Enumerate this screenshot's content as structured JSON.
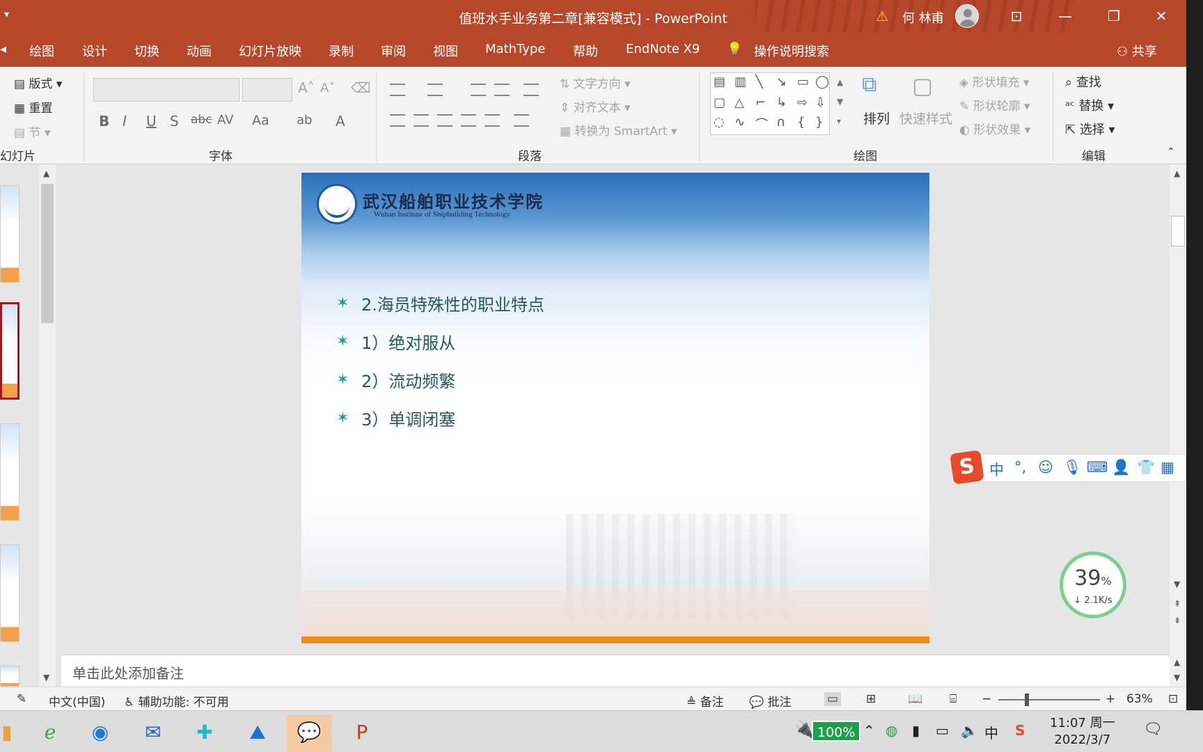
{
  "window": {
    "title": "值班水手业务第二章[兼容模式]  -  PowerPoint",
    "user_name": "何 林甫",
    "warning_icon": "warning-icon",
    "title_bar_color": "#b7472a"
  },
  "tabs": [
    "绘图",
    "设计",
    "切换",
    "动画",
    "幻灯片放映",
    "录制",
    "审阅",
    "视图",
    "MathType",
    "帮助",
    "EndNote X9"
  ],
  "tell_me": "操作说明搜索",
  "share": "共享",
  "ribbon": {
    "slides_group": {
      "layout": "版式",
      "reset": "重置",
      "section": "节",
      "label": "幻灯片"
    },
    "font_group": {
      "label": "字体"
    },
    "paragraph_group": {
      "text_direction": "文字方向",
      "align_text": "对齐文本",
      "smartart": "转换为 SmartArt",
      "label": "段落"
    },
    "drawing_group": {
      "arrange": "排列",
      "quick_styles": "快速样式",
      "shape_fill": "形状填充",
      "shape_outline": "形状轮廓",
      "shape_effects": "形状效果",
      "label": "绘图"
    },
    "editing_group": {
      "find": "查找",
      "replace": "替换",
      "select": "选择",
      "label": "编辑"
    }
  },
  "slide": {
    "logo_cn": "武汉船舶职业技术学院",
    "logo_en": "Wuhan Institute of Shipbuilding Technology",
    "bullets": [
      "2.海员特殊性的职业特点",
      "1）绝对服从",
      "2）流动频繁",
      "3）单调闭塞"
    ],
    "bullet_symbol": "✶",
    "accent_color": "#f08a1c",
    "text_color": "#245a5a"
  },
  "notes_placeholder": "单击此处添加备注",
  "status": {
    "language": "中文(中国)",
    "accessibility": "辅助功能: 不可用",
    "notes_btn": "备注",
    "comments_btn": "批注",
    "zoom": "63%",
    "zoom_minus": "−",
    "zoom_plus": "+"
  },
  "ime": {
    "logo": "S",
    "mode": "中",
    "punct": "°,"
  },
  "network": {
    "percent": "39",
    "percent_unit": "%",
    "speed": "↓ 2.1K/s"
  },
  "taskbar": {
    "battery": "100%",
    "ime_indicator": "中",
    "time": "11:07 周一",
    "date": "2022/3/7"
  }
}
